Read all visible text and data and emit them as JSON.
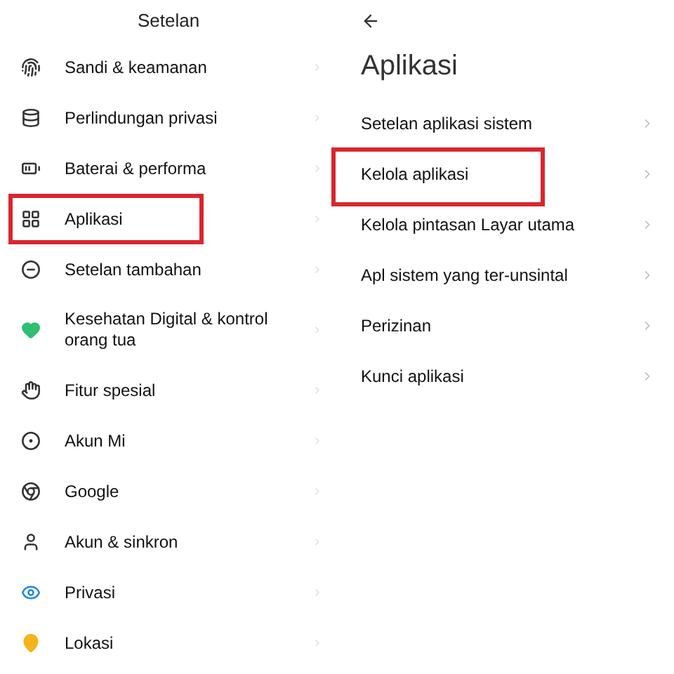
{
  "settings_panel": {
    "title": "Setelan",
    "items": [
      {
        "label": "Sandi & keamanan",
        "highlighted": false
      },
      {
        "label": "Perlindungan privasi",
        "highlighted": false
      },
      {
        "label": "Baterai & performa",
        "highlighted": false
      },
      {
        "label": "Aplikasi",
        "highlighted": true
      },
      {
        "label": "Setelan tambahan",
        "highlighted": false
      },
      {
        "label": "Kesehatan Digital & kontrol orang tua",
        "highlighted": false
      },
      {
        "label": "Fitur spesial",
        "highlighted": false
      },
      {
        "label": "Akun Mi",
        "highlighted": false
      },
      {
        "label": "Google",
        "highlighted": false
      },
      {
        "label": "Akun & sinkron",
        "highlighted": false
      },
      {
        "label": "Privasi",
        "highlighted": false
      },
      {
        "label": "Lokasi",
        "highlighted": false
      }
    ]
  },
  "apps_panel": {
    "title": "Aplikasi",
    "items": [
      {
        "label": "Setelan aplikasi sistem",
        "highlighted": false
      },
      {
        "label": "Kelola aplikasi",
        "highlighted": true
      },
      {
        "label": "Kelola pintasan Layar utama",
        "highlighted": false
      },
      {
        "label": "Apl sistem yang ter-unsintal",
        "highlighted": false
      },
      {
        "label": "Perizinan",
        "highlighted": false
      },
      {
        "label": "Kunci aplikasi",
        "highlighted": false
      }
    ]
  }
}
